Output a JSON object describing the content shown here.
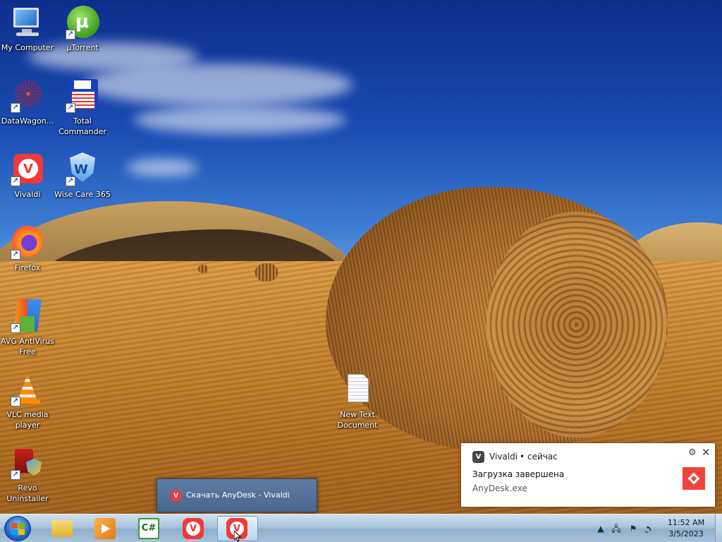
{
  "desktop": {
    "icons": [
      {
        "label": "My Computer",
        "icon": "computer-icon"
      },
      {
        "label": "µTorrent",
        "icon": "utorrent-icon"
      },
      {
        "label": "DataWagon...",
        "icon": "datawagon-icon"
      },
      {
        "label": "Total Commander",
        "icon": "total-commander-icon"
      },
      {
        "label": "Vivaldi",
        "icon": "vivaldi-icon"
      },
      {
        "label": "Wise Care 365",
        "icon": "wise-care-icon"
      },
      {
        "label": "Firefox",
        "icon": "firefox-icon"
      },
      {
        "label": "AVG AntiVirus Free",
        "icon": "avg-icon"
      },
      {
        "label": "VLC media player",
        "icon": "vlc-icon"
      },
      {
        "label": "Revo Uninstaller",
        "icon": "revo-icon"
      },
      {
        "label": "New Text Document",
        "icon": "text-document-icon"
      }
    ]
  },
  "taskbar": {
    "thumbnail": {
      "title": "Скачать AnyDesk - Vivaldi"
    },
    "clock": {
      "time": "11:52 AM",
      "date": "3/5/2023"
    }
  },
  "notification": {
    "app": "Vivaldi",
    "separator": "•",
    "time": "сейчас",
    "title": "Загрузка завершена",
    "body": "AnyDesk.exe"
  },
  "colors": {
    "vivaldi_red": "#ef3939",
    "anydesk_red": "#ef443b",
    "taskbar": "#a9c4dc"
  }
}
